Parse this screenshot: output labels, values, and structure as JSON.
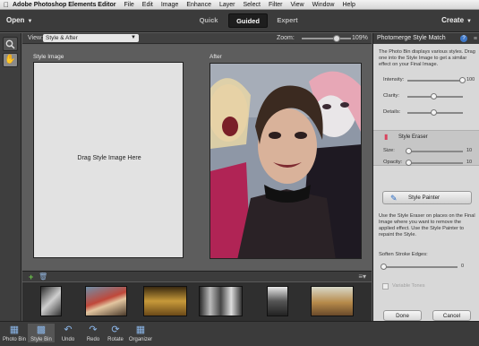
{
  "menubar": {
    "apple": "",
    "app_name": "Adobe Photoshop Elements Editor",
    "items": [
      "File",
      "Edit",
      "Image",
      "Enhance",
      "Layer",
      "Select",
      "Filter",
      "View",
      "Window",
      "Help"
    ]
  },
  "modebar": {
    "open_label": "Open",
    "tabs": [
      "Quick",
      "Guided",
      "Expert"
    ],
    "active_tab": "Guided",
    "create_label": "Create"
  },
  "viewbar": {
    "view_label": "View:",
    "view_value": "Style & After",
    "zoom_label": "Zoom:",
    "zoom_value": "109%",
    "zoom_level": 0.66
  },
  "canvas": {
    "style_image_label": "Style Image",
    "style_image_hint": "Drag Style Image Here",
    "after_label": "After"
  },
  "panel": {
    "title": "Photomerge Style Match",
    "description": "The Photo Bin displays various styles. Drag one into the Style Image to get a similar effect on your Final Image.",
    "intensity_label": "Intensity:",
    "intensity_value": "100",
    "clarity_label": "Clarity:",
    "details_label": "Details:",
    "clarity_level": 0.52,
    "details_level": 0.52,
    "style_eraser_label": "Style Eraser",
    "size_label": "Size:",
    "size_value": "10",
    "opacity_label": "Opacity:",
    "opacity_value": "10",
    "style_painter_label": "Style Painter",
    "painter_description": "Use the Style Eraser on places on the Final Image where you want to remove the applied effect. Use the Style Painter to repaint the Style.",
    "soften_label": "Soften Stroke Edges:",
    "soften_value": "0",
    "variable_tones_label": "Variable Tones",
    "done_label": "Done",
    "cancel_label": "Cancel"
  },
  "bottombar": {
    "items": [
      "Photo Bin",
      "Style Bin",
      "Undo",
      "Redo",
      "Rotate",
      "Organizer"
    ]
  },
  "colors": {
    "accent_blue": "#3f78c8",
    "eraser_pink": "#d9445e",
    "add_green": "#6bc24a"
  }
}
